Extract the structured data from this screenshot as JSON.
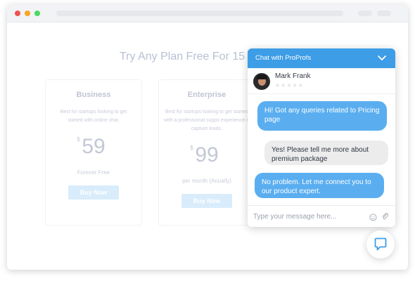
{
  "page": {
    "headline": "Try Any Plan Free For 15",
    "plans": [
      {
        "name": "Business",
        "description": "Best for startups looking to get started with online chat.",
        "currency": "$",
        "price": "59",
        "period": "Forever Free",
        "button": "Buy Now"
      },
      {
        "name": "Enterprise",
        "description": "Best for startups looking to get started with a professional suppo experience & capture leads.",
        "currency": "$",
        "price": "99",
        "period": "per month (Anually)",
        "button": "Buy Now"
      }
    ]
  },
  "chat": {
    "title": "Chat with ProProfs",
    "agent_name": "Mark Frank",
    "rating_stars": "★★★★★",
    "messages": [
      {
        "from": "agent",
        "text": "Hi! Got any queries related to Pricing page"
      },
      {
        "from": "visitor",
        "text": "Yes! Please tell me more about premium package"
      },
      {
        "from": "agent",
        "text": "No problem. Let me connect you to our product expert."
      }
    ],
    "input_placeholder": "Type your message here..."
  },
  "colors": {
    "accent": "#3d9de6",
    "agent_bubble": "#5aaef0",
    "visitor_bubble": "#ececed"
  },
  "icons": [
    "chevron-down-icon",
    "emoji-icon",
    "paperclip-icon",
    "chat-bubble-icon"
  ]
}
